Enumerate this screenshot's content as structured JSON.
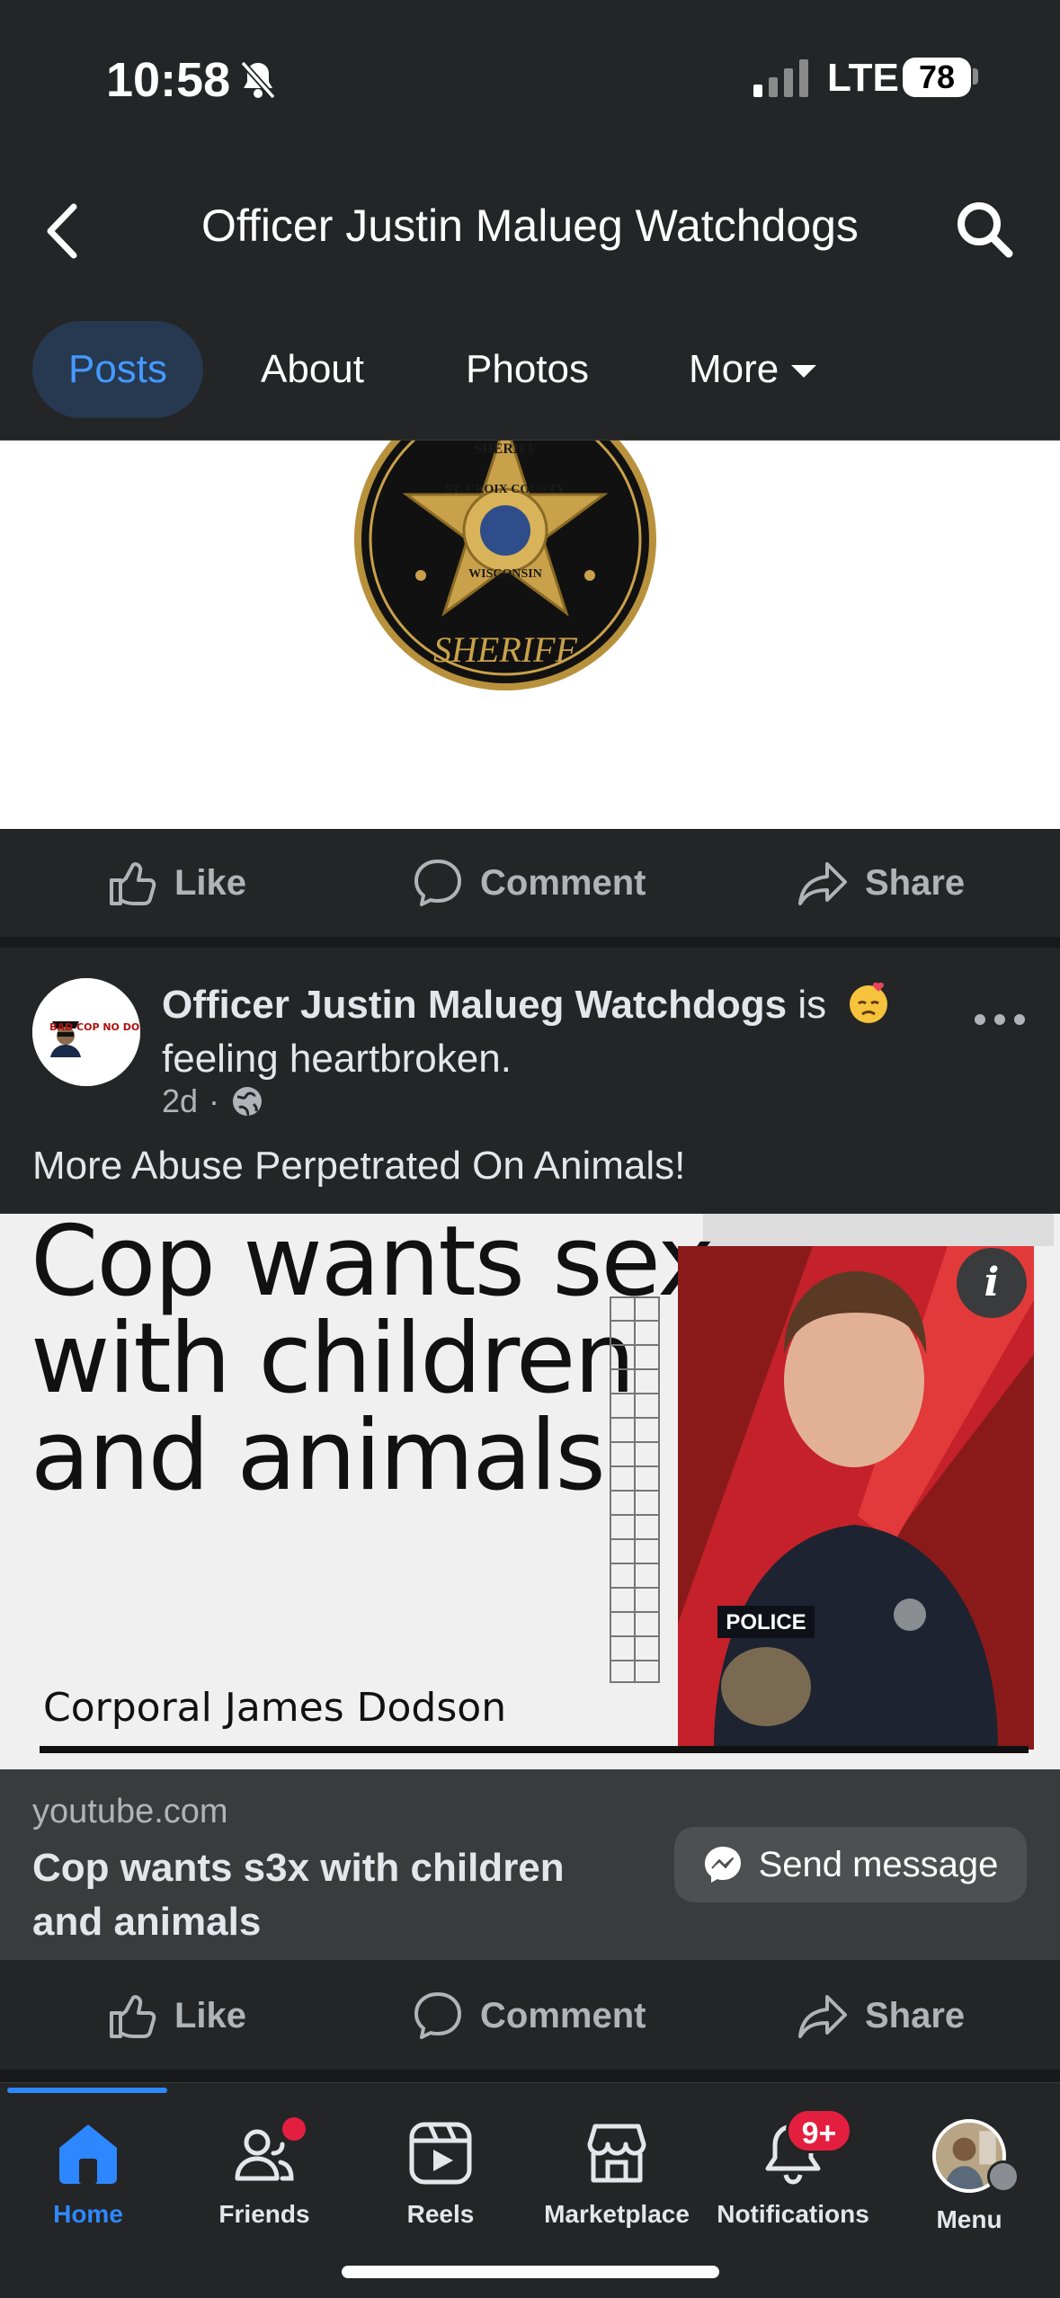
{
  "status_bar": {
    "time": "10:58",
    "network": "LTE",
    "battery": "78"
  },
  "header": {
    "title": "Officer Justin Malueg Watchdogs"
  },
  "tabs": [
    {
      "label": "Posts"
    },
    {
      "label": "About"
    },
    {
      "label": "Photos"
    },
    {
      "label": "More"
    }
  ],
  "badge_image": {
    "top_text": "SHERIFF",
    "ring_text": "ST. CROIX COUNTY",
    "state_text": "WISCONSIN",
    "bottom_text": "SHERIFF"
  },
  "post_actions": {
    "like": "Like",
    "comment": "Comment",
    "share": "Share"
  },
  "post": {
    "avatar_text": "BAD COP NO DONUT",
    "author": "Officer Justin Malueg Watchdogs",
    "feeling_prefix": "is",
    "feeling": "feeling heartbroken.",
    "time": "2d",
    "text": "More Abuse Perpetrated On Animals!",
    "thumbnail": {
      "headline": [
        "Cop wants sex",
        "with children",
        "and animals"
      ],
      "caption": "Corporal James Dodson",
      "patch_text": "POLICE"
    },
    "link": {
      "domain": "youtube.com",
      "title": "Cop wants s3x with children and animals",
      "send_label": "Send message"
    }
  },
  "bottom_nav": [
    {
      "label": "Home",
      "icon": "home-icon"
    },
    {
      "label": "Friends",
      "icon": "friends-icon"
    },
    {
      "label": "Reels",
      "icon": "reels-icon"
    },
    {
      "label": "Marketplace",
      "icon": "marketplace-icon"
    },
    {
      "label": "Notifications",
      "icon": "bell-icon",
      "badge": "9+"
    },
    {
      "label": "Menu",
      "icon": "menu-avatar-icon"
    }
  ],
  "colors": {
    "background": "#242526",
    "accent": "#2d88ff",
    "badge_red": "#e41e3f",
    "tab_active_bg": "#263951"
  }
}
